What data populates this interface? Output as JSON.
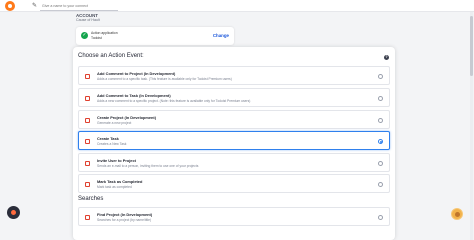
{
  "topbar": {
    "name_placeholder": "Give a name to your connect"
  },
  "account": {
    "heading": "ACCOUNT",
    "subtitle": "Cause of Hault"
  },
  "app": {
    "label": "Action application",
    "value": "Todoist",
    "change_label": "Change"
  },
  "panel": {
    "title": "Choose an Action Event:",
    "help": "?",
    "events": [
      {
        "title": "Add Comment to Project (In Development)",
        "desc": "Adds a comment to a specific task. (This feature is available only for Todoist Premium users)",
        "selected": false
      },
      {
        "title": "Add Comment to Task (In Development)",
        "desc": "Adds a new comment to a specific project. (Note: this feature is available only for Todoist Premium users)",
        "selected": false
      },
      {
        "title": "Create Project (In Development)",
        "desc": "Generate a new project",
        "selected": false
      },
      {
        "title": "Create Task",
        "desc": "Creates a New Task",
        "selected": true
      },
      {
        "title": "Invite User to Project",
        "desc": "Sends an e-mail to a person, inviting them to use one of your projects",
        "selected": false
      },
      {
        "title": "Mark Task as Completed",
        "desc": "Mark task as completed",
        "selected": false
      }
    ],
    "searches_title": "Searches",
    "searches": [
      {
        "title": "Find Project (In Development)",
        "desc": "Searches for a project (by name/title)",
        "selected": false
      }
    ]
  },
  "colors": {
    "accent": "#2f80ed",
    "brand": "#ff7a1a",
    "app_icon": "#e0402f",
    "success": "#14a44d"
  },
  "icons": {
    "logo": "brand-logo-icon",
    "edit": "pencil-icon",
    "check": "check-circle-icon",
    "help": "help-icon",
    "app": "todoist-icon"
  }
}
